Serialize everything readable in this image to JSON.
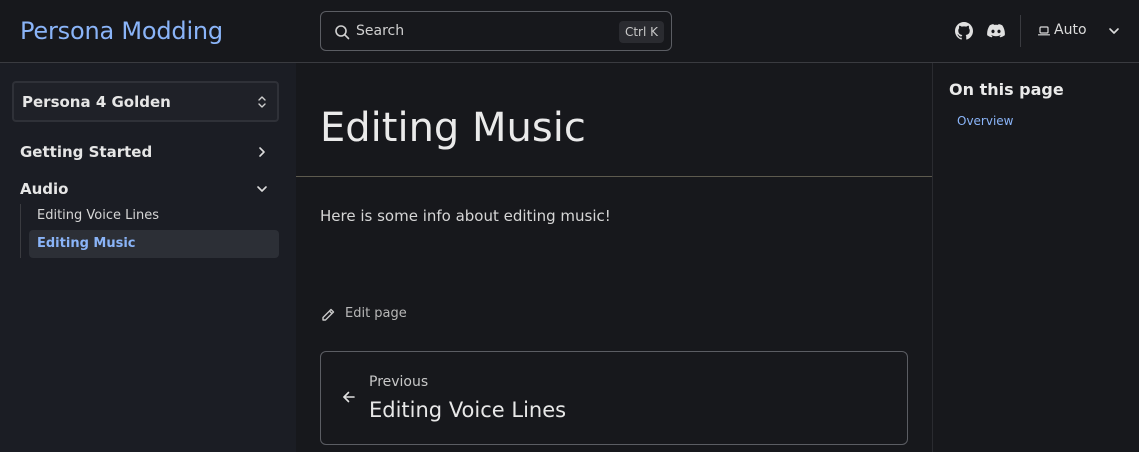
{
  "header": {
    "site_title": "Persona Modding",
    "search": {
      "placeholder": "Search",
      "shortcut": "Ctrl K"
    },
    "theme": {
      "label": "Auto"
    },
    "icons": [
      "search-icon",
      "github-icon",
      "discord-icon",
      "laptop-icon",
      "chevron-down-icon"
    ]
  },
  "sidebar": {
    "game_select": "Persona 4 Golden",
    "groups": [
      {
        "label": "Getting Started",
        "expanded": false
      },
      {
        "label": "Audio",
        "expanded": true,
        "items": [
          {
            "label": "Editing Voice Lines",
            "active": false
          },
          {
            "label": "Editing Music",
            "active": true
          }
        ]
      }
    ]
  },
  "main": {
    "title": "Editing Music",
    "body": "Here is some info about editing music!",
    "edit_label": "Edit page",
    "pagination": {
      "kicker": "Previous",
      "target": "Editing Voice Lines"
    }
  },
  "toc": {
    "heading": "On this page",
    "items": [
      "Overview"
    ]
  },
  "colors": {
    "background": "#17181c",
    "sidebar": "#1b1d24",
    "accent": "#8ab4f8",
    "active_item_bg": "#2c2f36"
  }
}
